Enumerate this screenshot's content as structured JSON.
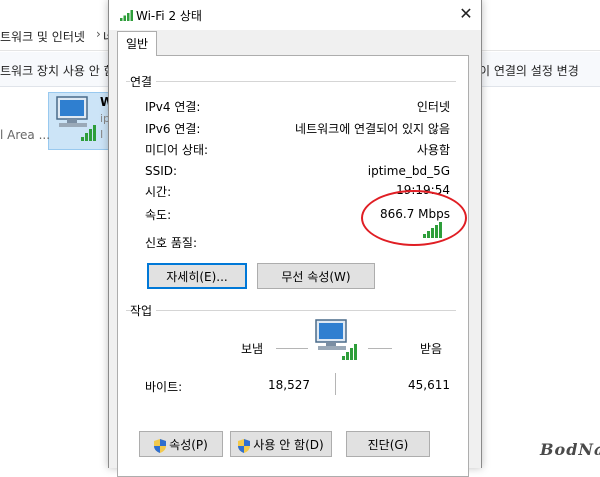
{
  "background": {
    "breadcrumb": "트워크 및 인터넷",
    "breadcrumb_next": "네",
    "cmd_left": "트워크 장치 사용 안 함",
    "cmd_right": "이 연결의 설정 변경",
    "item_name": "W",
    "item_sub1": "ip",
    "item_sub2": "I",
    "area_text": "l Area ..."
  },
  "dialog": {
    "title": "Wi-Fi 2 상태",
    "close_glyph": "✕",
    "tab_general": "일반",
    "connection": {
      "group_label": "연결",
      "rows": [
        {
          "label": "IPv4 연결:",
          "value": "인터넷"
        },
        {
          "label": "IPv6 연결:",
          "value": "네트워크에 연결되어 있지 않음"
        },
        {
          "label": "미디어 상태:",
          "value": "사용함"
        },
        {
          "label": "SSID:",
          "value": "iptime_bd_5G"
        },
        {
          "label": "시간:",
          "value": "19:19:54"
        },
        {
          "label": "속도:",
          "value": "866.7 Mbps"
        }
      ],
      "signal_label": "신호 품질:",
      "details_button": "자세히(E)...",
      "wireless_props_button": "무선 속성(W)"
    },
    "activity": {
      "group_label": "작업",
      "sent_label": "보냄",
      "received_label": "받음",
      "bytes_label": "바이트:",
      "sent_bytes": "18,527",
      "received_bytes": "45,611"
    },
    "buttons": {
      "properties": "속성(P)",
      "disable": "사용 안 함(D)",
      "diagnose": "진단(G)"
    }
  },
  "watermark": "BodNara",
  "colors": {
    "signal_green": "#2e9e3a",
    "highlight_red": "#e01e24",
    "accent_blue": "#0078d7"
  }
}
